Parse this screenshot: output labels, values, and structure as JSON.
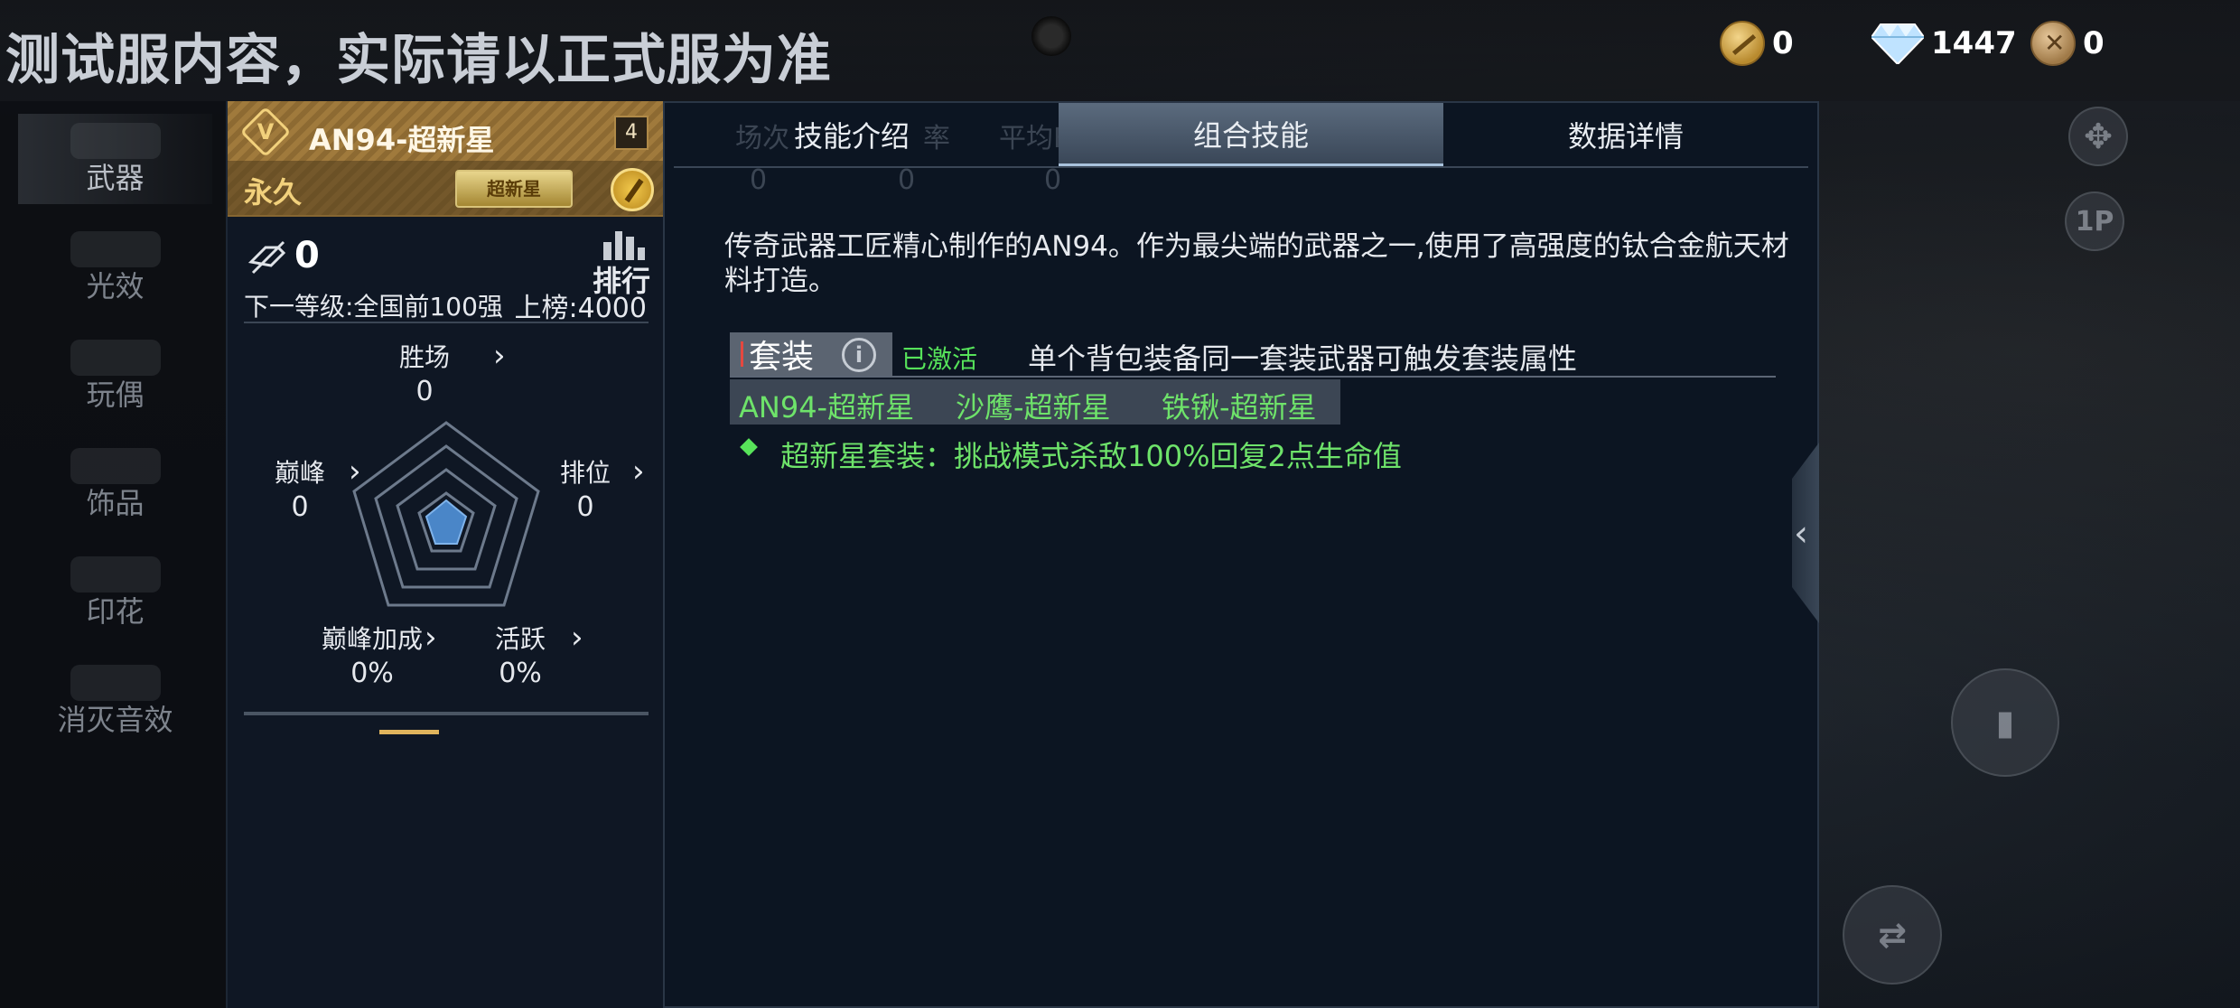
{
  "banner": "测试服内容，实际请以正式服为准",
  "currency": {
    "gold": "0",
    "diamond": "1447",
    "medal": "0"
  },
  "sidebar": {
    "items": [
      {
        "label": "武器"
      },
      {
        "label": "光效"
      },
      {
        "label": "玩偶"
      },
      {
        "label": "饰品"
      },
      {
        "label": "印花"
      },
      {
        "label": "消灭音效"
      }
    ]
  },
  "weapon": {
    "badge": "V",
    "name": "AN94-超新星",
    "level": "4",
    "duration": "永久",
    "tag": "超新星",
    "kills": "0",
    "rank_label": "排行",
    "next_level": "下一等级:全国前100强",
    "upboard": "上榜:4000",
    "stats": {
      "wins_label": "胜场",
      "wins": "0",
      "peak_label": "巅峰",
      "peak": "0",
      "ranked_label": "排位",
      "ranked": "0",
      "peak_bonus_label": "巅峰加成",
      "peak_bonus": "0%",
      "active_label": "活跃",
      "active": "0%"
    }
  },
  "tabs": [
    {
      "label": "技能介绍"
    },
    {
      "label": "组合技能"
    },
    {
      "label": "数据详情"
    }
  ],
  "ghost": {
    "col1": "场次",
    "col2": "率",
    "col3": "平均KDA",
    "v1": "0",
    "v2": "0",
    "v3": "0"
  },
  "description": "传奇武器工匠精心制作的AN94。作为最尖端的武器之一,使用了高强度的钛合金航天材料打造。",
  "set": {
    "tab_label": "套装",
    "info_icon": "i",
    "status": "已激活",
    "tip": "单个背包装备同一套装武器可触发套装属性",
    "items": [
      "AN94-超新星",
      "沙鹰-超新星",
      "铁锹-超新星"
    ],
    "effect": "超新星套装：挑战模式杀敌100%回复2点生命值"
  },
  "side_buttons": {
    "view": "1P"
  },
  "colors": {
    "accent_green": "#6ee36a",
    "gold": "#f2d17c",
    "panel_bg": "#0c1522"
  }
}
